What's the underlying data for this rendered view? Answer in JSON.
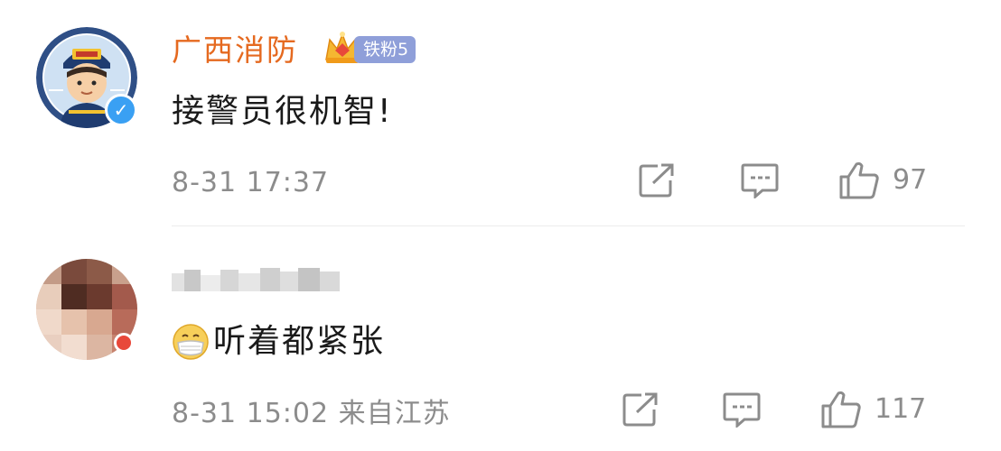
{
  "comments": [
    {
      "username": "广西消防",
      "verified": true,
      "fan_badge": "铁粉5",
      "avatar_icon": "firefighter-cartoon-avatar",
      "text": "接警员很机智!",
      "timestamp": "8-31 17:37",
      "location": "",
      "likes": "97"
    },
    {
      "username": "",
      "verified": false,
      "avatar_icon": "blurred-photo-avatar",
      "emoji_icon": "face-with-medical-mask-emoji",
      "text": "听着都紧张",
      "timestamp": "8-31 15:02",
      "location": "来自江苏",
      "likes": "117"
    }
  ],
  "colors": {
    "username_official": "#e5691f",
    "meta_gray": "#8c8c8c",
    "verified_blue": "#3aa0f3",
    "fan_badge_bg": "#8f9fd9",
    "text": "#1a1a1a"
  }
}
